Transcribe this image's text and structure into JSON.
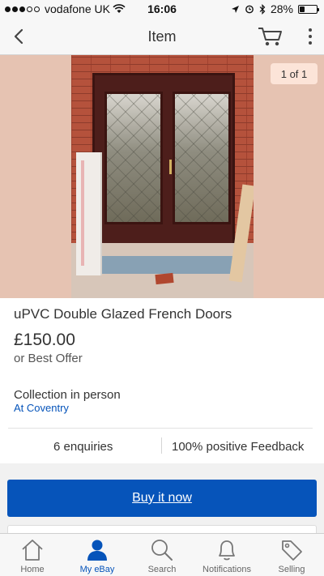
{
  "status_bar": {
    "carrier": "vodafone UK",
    "time": "16:06",
    "battery": "28%",
    "battery_level": 0.28
  },
  "nav": {
    "title": "Item",
    "back_icon": "chevron-left-icon",
    "cart_icon": "cart-icon",
    "more_icon": "more-vertical-icon"
  },
  "gallery": {
    "counter": "1 of 1"
  },
  "item": {
    "title": "uPVC Double Glazed French Doors",
    "price": "£150.00",
    "offer": "or Best Offer",
    "collection": "Collection in person",
    "location": "At Coventry",
    "enquiries": "6 enquiries",
    "feedback": "100% positive Feedback"
  },
  "actions": {
    "buy_label": "Buy it now"
  },
  "tabs": [
    {
      "label": "Home",
      "icon": "home-icon",
      "active": false
    },
    {
      "label": "My eBay",
      "icon": "user-icon",
      "active": true
    },
    {
      "label": "Search",
      "icon": "search-icon",
      "active": false
    },
    {
      "label": "Notifications",
      "icon": "bell-icon",
      "active": false
    },
    {
      "label": "Selling",
      "icon": "tag-icon",
      "active": false
    }
  ],
  "colors": {
    "accent": "#0654ba",
    "bar_background": "#f7f7f7",
    "photo_backdrop": "#e6c3b2"
  }
}
